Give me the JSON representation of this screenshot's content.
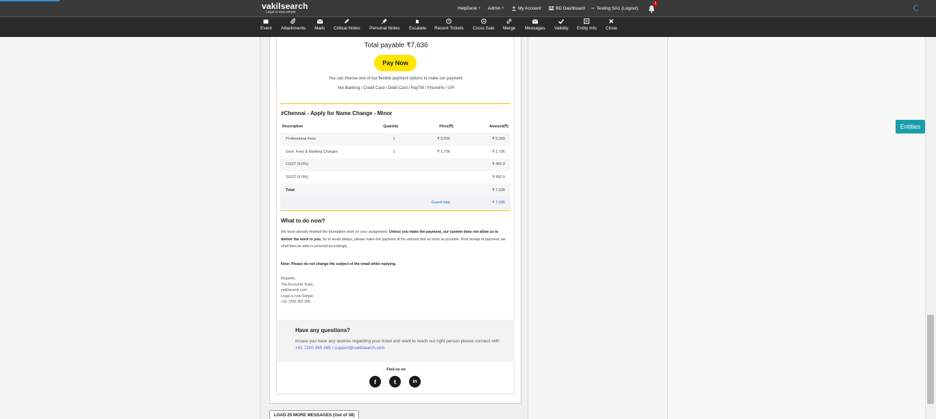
{
  "header": {
    "logo_name": "vakilsearch",
    "logo_tag": "Legal is now simple",
    "nav": [
      {
        "label": "HelpDesk",
        "caret": "▾"
      },
      {
        "label": "Admin",
        "caret": "▾"
      },
      {
        "label": "My Account",
        "icon": "user-icon"
      },
      {
        "label": "BD Dashboard",
        "icon": "dashboard-icon"
      },
      {
        "label": "Testing SA1 (Logout)",
        "icon": "logout-icon"
      }
    ],
    "notification_count": "1"
  },
  "toolbar": {
    "items": [
      {
        "label": "Event",
        "icon": "calendar-icon"
      },
      {
        "label": "Attachments",
        "icon": "paperclip-icon"
      },
      {
        "label": "Mails",
        "icon": "mail-icon"
      },
      {
        "label": "Critical Notes",
        "icon": "pencil-icon"
      },
      {
        "label": "Personal Notes",
        "icon": "pin-icon"
      },
      {
        "label": "Escalate",
        "icon": "escalate-icon"
      },
      {
        "label": "Recent Tickets",
        "icon": "clock-icon"
      },
      {
        "label": "Cross Sale",
        "icon": "cross-sale-icon"
      },
      {
        "label": "Merge",
        "icon": "link-icon"
      },
      {
        "label": "Messages",
        "icon": "message-icon"
      },
      {
        "label": "Validity",
        "icon": "check-icon"
      },
      {
        "label": "Entity Info",
        "icon": "entity-icon"
      },
      {
        "label": "Close",
        "icon": "close-icon"
      }
    ]
  },
  "entities_button": "Entities",
  "email": {
    "total_payable": "Total payable ₹7,636",
    "pay_now": "Pay Now",
    "pay_info": "You can choose one of our flexible payment options to make our payment.",
    "pay_methods": "Net Banking / Credit Card / Debit Card / PayTM / PhonePe / UPI",
    "order_title": "#Chennai - Apply for Name Change - Minor",
    "table": {
      "headers": [
        "Description",
        "Quantity",
        "Price(₹)",
        "Amount(₹)"
      ],
      "rows": [
        [
          "Professional Fees",
          "1",
          "₹ 5,000",
          "₹ 5,000"
        ],
        [
          "Govt. Fees & Banking Charges",
          "1",
          "₹ 1,736",
          "₹ 1,736"
        ],
        [
          "CGST (9.0%)",
          "",
          "",
          "₹ 450.0"
        ],
        [
          "SGST (9.0%)",
          "",
          "",
          "₹ 450.0"
        ],
        [
          "Total",
          "",
          "",
          "₹ 7,636"
        ]
      ],
      "grand_label": "Grand total",
      "grand_value": "₹ 7,636"
    },
    "what_title": "What to do now?",
    "what_part1": "We have already finished the foundation work on your assignment. ",
    "what_bold": "Unless you make the payment, our system does not allow us to deliver the work to you.",
    "what_part2": " So to avoid delays, please make the payment of the amount due as soon as possible. Post receipt of payment, we shall then be able to proceed accordingly.",
    "note": "Note: Please do not change the subject of the email while replying.",
    "sign_lines": [
      "Regards,",
      "The Accounts Team,",
      "vakilsearch.com",
      "Legal is now Simple",
      "+91 7200 365 365"
    ],
    "questions_title": "Have any questions?",
    "questions_body": "Incase you have any queries regarding your ticket and want to reach out right person please connect with ",
    "questions_link": "+91 7200 365 365 / support@vakilsearch.com",
    "find_us": "Find us on",
    "social": [
      {
        "name": "facebook-icon",
        "glyph": "f"
      },
      {
        "name": "twitter-icon",
        "glyph": "t"
      },
      {
        "name": "linkedin-icon",
        "glyph": "in"
      }
    ]
  },
  "load_more": "LOAD 25 MORE MESSAGES (Out of 38)",
  "colors": {
    "header_bg": "#3a3a3a",
    "toolbar_bg": "#2a2a2a",
    "pay_button": "#ffe400",
    "divider": "#e8c300",
    "entities": "#1a9dab",
    "link": "#3b6fd6"
  }
}
